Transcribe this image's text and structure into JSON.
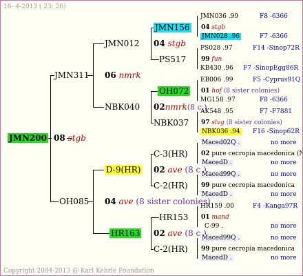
{
  "header": "16-  4-2013 ( 23: 26)",
  "watermark": "Copyright 2004-2013 @ Karl Kehrle Foundation",
  "root": {
    "name": "JMN200",
    "gen": "08",
    "tag": "stgb"
  },
  "sire": "JMN311",
  "dam": "OH085",
  "sire_sire": {
    "name": "JMN012",
    "gen": "06",
    "tag": "nmrk"
  },
  "sire_dam": {
    "name": "NBK040",
    "gen": "02",
    "tag": "nmrk",
    "suffix": "(8 c.)"
  },
  "dam_sire": {
    "name": "D-9(HR)",
    "gen": "04",
    "tag": "ave",
    "suffix": "(8 sister colonies)"
  },
  "dam_dam": {
    "name": "HR163",
    "gen": "02",
    "tag": "ave",
    "suffix": "(8 c.)"
  },
  "g4": {
    "a": {
      "name": "JMN156",
      "gen": "04",
      "tag": "stgb"
    },
    "b": {
      "name": "PS517",
      "gen": "99",
      "tag": "fun"
    },
    "c": {
      "name": "OH072",
      "gen": "01",
      "tag": "hof",
      "suffix": "(8 sister colonies)"
    },
    "d": {
      "name": "NBK037",
      "gen": "97",
      "tag": "slvg",
      "suffix": "(8 sister colonies)"
    },
    "e": {
      "name": "C-3(HR)",
      "gen": "02",
      "tag": "pure cecropia macedonica (North-M"
    },
    "f": {
      "name": "C-2(HR)",
      "gen": "99",
      "tag": "pure cecropia macedonica"
    },
    "g": {
      "name": "HR153",
      "gen": "01",
      "tag": "mand"
    },
    "h": {
      "name": "C-2(HR)",
      "gen": "99",
      "tag": "pure cecropia macedonica"
    }
  },
  "g5": [
    {
      "left": "JMN036 .99",
      "right": "F8 -6366"
    },
    {
      "left": "JMN028 .96",
      "right": "F7 -6366"
    },
    {
      "left": "PS028 .97",
      "right": "F14 -Sinop72R"
    },
    {
      "left": "KB430 .96",
      "right": "F7 -SinopEgg86R"
    },
    {
      "left": "EB006 .99",
      "right": "F5 -Cyprus91Q"
    },
    {
      "left": "MG158 .97",
      "right": "F8 -6366"
    },
    {
      "left": "AK548 .95",
      "right": "F7 -F7881"
    },
    {
      "left": "NBK036 .94",
      "right": "F16 -Sinop62R"
    },
    {
      "left": "Maced02Q .",
      "right": "no more"
    },
    {
      "left": "MacedD .",
      "right": "no more"
    },
    {
      "left": "Maced99Q .",
      "right": "no more"
    },
    {
      "left": "MacedD .",
      "right": "no more"
    },
    {
      "left": "HR159 .00",
      "right": "F4 -Kanga97R"
    },
    {
      "left": "C-99 .",
      "right": "no more"
    },
    {
      "left": "Maced99Q .",
      "right": "no more"
    },
    {
      "left": "MacedD .",
      "right": "no more"
    }
  ]
}
